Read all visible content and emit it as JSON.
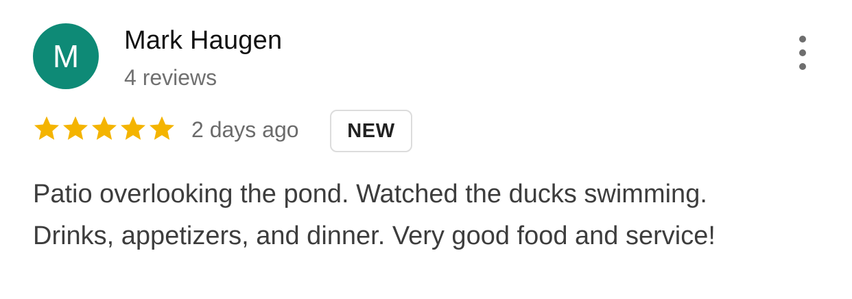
{
  "review": {
    "author": {
      "initial": "M",
      "name": "Mark Haugen",
      "reviews_count": "4 reviews",
      "avatar_color": "#0e8a76"
    },
    "rating": 5,
    "max_rating": 5,
    "star_color": "#f4b400",
    "date": "2 days ago",
    "badge": "NEW",
    "text": "Patio overlooking the pond. Watched the ducks swimming. Drinks, appetizers, and dinner. Very good food and service!",
    "menu_icon": "more-vert-icon"
  }
}
